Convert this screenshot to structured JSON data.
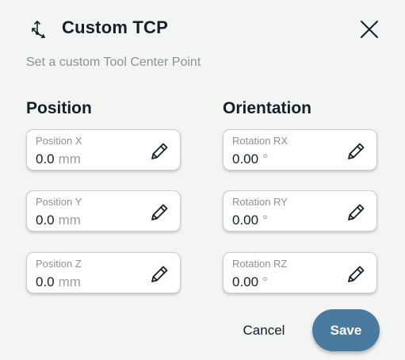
{
  "header": {
    "title": "Custom TCP",
    "subtitle": "Set a custom Tool Center Point",
    "icon": "tcp-axes-icon",
    "close_icon": "close-icon"
  },
  "position": {
    "title": "Position",
    "fields": [
      {
        "label": "Position X",
        "value": "0.0",
        "unit": "mm"
      },
      {
        "label": "Position Y",
        "value": "0.0",
        "unit": "mm"
      },
      {
        "label": "Position Z",
        "value": "0.0",
        "unit": "mm"
      }
    ]
  },
  "orientation": {
    "title": "Orientation",
    "fields": [
      {
        "label": "Rotation RX",
        "value": "0.00",
        "unit": "°"
      },
      {
        "label": "Rotation RY",
        "value": "0.00",
        "unit": "°"
      },
      {
        "label": "Rotation RZ",
        "value": "0.00",
        "unit": "°"
      }
    ]
  },
  "actions": {
    "cancel_label": "Cancel",
    "save_label": "Save"
  },
  "colors": {
    "background": "#f3f4f4",
    "text_primary": "#13202a",
    "text_secondary": "#8b9298",
    "accent": "#4a7b9e"
  }
}
